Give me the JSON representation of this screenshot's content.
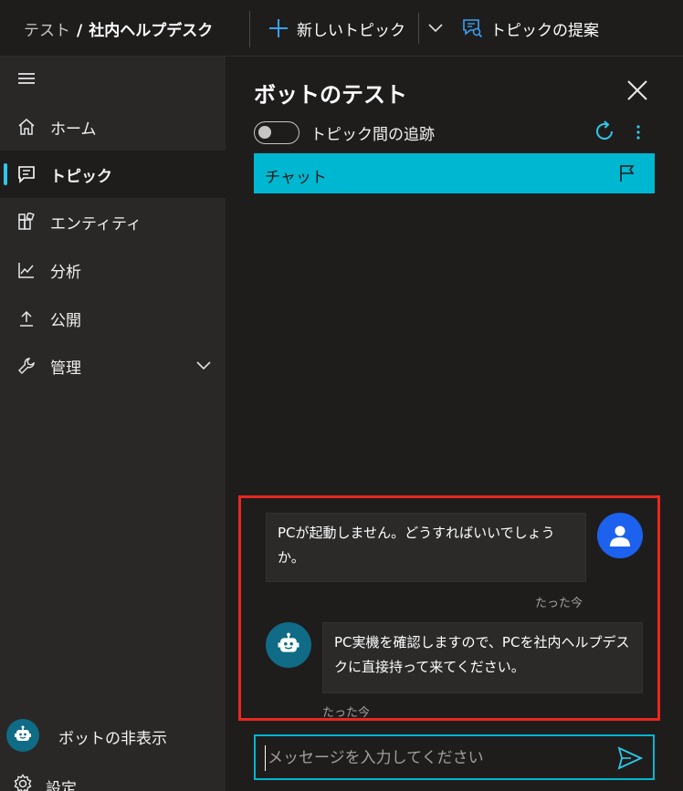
{
  "header": {
    "breadcrumb_parent": "テスト",
    "breadcrumb_separator": "/",
    "breadcrumb_current": "社内ヘルプデスク",
    "new_topic_label": "新しいトピック",
    "suggest_topic_label": "トピックの提案"
  },
  "sidebar": {
    "items": [
      {
        "label": "ホーム",
        "icon": "home-icon"
      },
      {
        "label": "トピック",
        "icon": "chat-icon",
        "active": true
      },
      {
        "label": "エンティティ",
        "icon": "entity-icon"
      },
      {
        "label": "分析",
        "icon": "chart-line-icon"
      },
      {
        "label": "公開",
        "icon": "upload-icon"
      },
      {
        "label": "管理",
        "icon": "wrench-icon"
      }
    ],
    "hide_bot_label": "ボットの非表示",
    "settings_label": "設定"
  },
  "test_panel": {
    "title": "ボットのテスト",
    "toggle_label": "トピック間の追跡",
    "toggle_on": false,
    "chat_tab_label": "チャット",
    "messages": [
      {
        "from": "user",
        "text": "PCが起動しません。どうすればいいでしょうか。",
        "time": "たった今"
      },
      {
        "from": "bot",
        "text": "PC実機を確認しますので、PCを社内ヘルプデスクに直接持って来てください。",
        "time": "たった今"
      }
    ],
    "input_placeholder": "メッセージを入力してください"
  },
  "colors": {
    "accent": "#00b7d1",
    "nav_active_bar": "#2ec8e8",
    "user_avatar": "#1d62ee",
    "bot_avatar": "#0f6b86",
    "highlight": "#e8281f"
  }
}
